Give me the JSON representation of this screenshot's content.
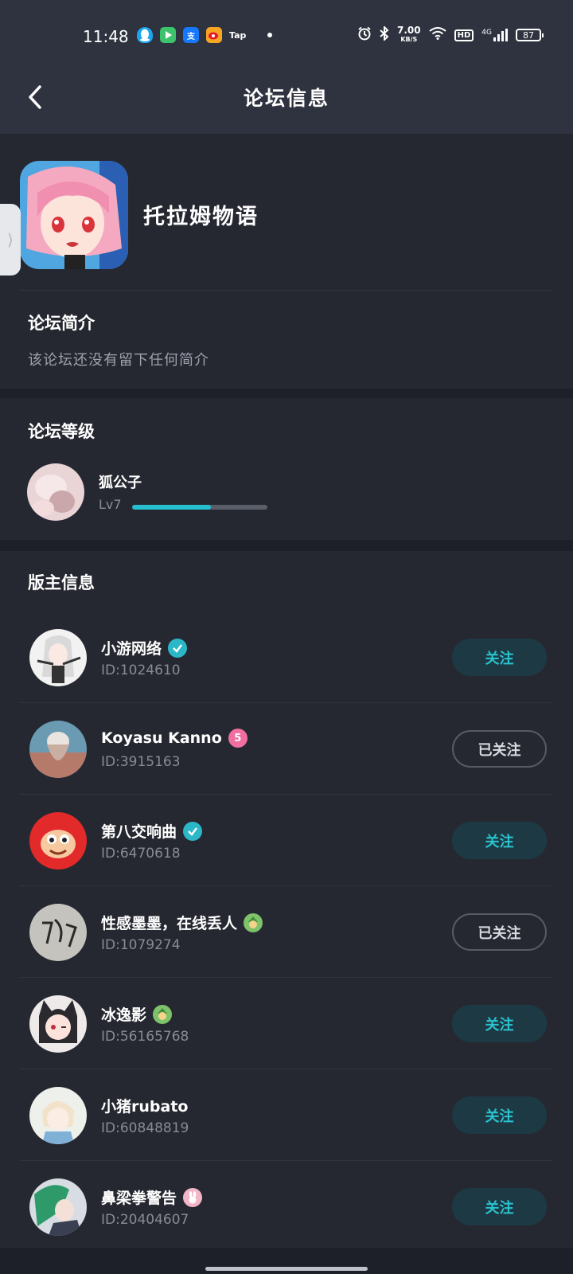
{
  "status_bar": {
    "time": "11:48",
    "speed_value": "7.00",
    "speed_unit": "KB/S",
    "hd": "HD",
    "network": "4G",
    "battery": "87",
    "tap": "Tap",
    "apps": [
      "qq-icon",
      "video-icon",
      "alipay-icon",
      "weibo-icon",
      "tap-icon"
    ]
  },
  "nav": {
    "title": "论坛信息"
  },
  "forum": {
    "name": "托拉姆物语",
    "intro_title": "论坛简介",
    "intro_text": "该论坛还没有留下任何简介"
  },
  "level": {
    "title": "论坛等级",
    "user": "狐公子",
    "lv": "Lv7",
    "progress": 0.58
  },
  "moderators": {
    "title": "版主信息",
    "items": [
      {
        "name": "小游网络",
        "id": "ID:1024610",
        "badge": "verified",
        "follow": "关注",
        "followed": false
      },
      {
        "name": "Koyasu Kanno",
        "id": "ID:3915163",
        "badge": "level-5",
        "follow": "已关注",
        "followed": true
      },
      {
        "name": "第八交响曲",
        "id": "ID:6470618",
        "badge": "verified",
        "follow": "关注",
        "followed": false
      },
      {
        "name": "性感墨墨，在线丢人",
        "id": "ID:1079274",
        "badge": "link",
        "follow": "已关注",
        "followed": true
      },
      {
        "name": "冰逸影",
        "id": "ID:56165768",
        "badge": "link",
        "follow": "关注",
        "followed": false
      },
      {
        "name": "小猪rubato",
        "id": "ID:60848819",
        "badge": "",
        "follow": "关注",
        "followed": false
      },
      {
        "name": "鼻梁拳警告",
        "id": "ID:20404607",
        "badge": "rabbit",
        "follow": "关注",
        "followed": false
      }
    ]
  },
  "colors": {
    "accent": "#26bfd0",
    "background": "#1e2029",
    "card": "#262831",
    "header": "#2f3340"
  }
}
